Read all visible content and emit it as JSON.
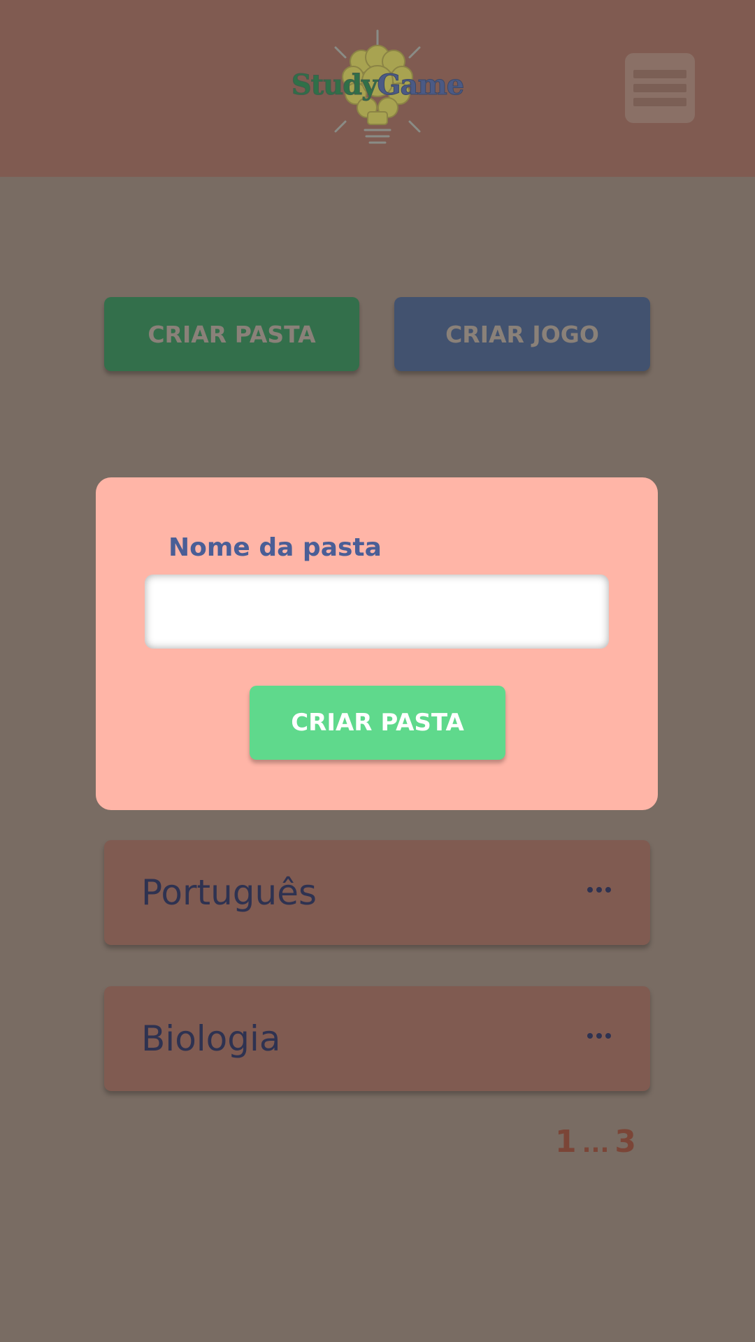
{
  "header": {
    "logo_part1": "Study",
    "logo_part2": "Game",
    "menu_icon": "hamburger-menu-icon"
  },
  "actions": {
    "create_folder_label": "CRIAR PASTA",
    "create_game_label": "CRIAR JOGO"
  },
  "form": {
    "field_label": "Nome da pasta",
    "field_value": "",
    "field_placeholder": "",
    "submit_label": "CRIAR PASTA"
  },
  "folders": [
    {
      "name": "Português",
      "menu_icon": "more-dots-icon"
    },
    {
      "name": "Biologia",
      "menu_icon": "more-dots-icon"
    }
  ],
  "pagination": {
    "current": "1",
    "separator": "...",
    "last": "3"
  },
  "colors": {
    "overlay_background": "#796c63",
    "header": "#805b51",
    "card": "#ffb5a7",
    "primary_green": "#5fd98c",
    "dim_green": "#336f4b",
    "dim_blue": "#42526f",
    "folder_row": "#805b51",
    "folder_text": "#2e3251",
    "label_blue": "#4a5e96",
    "pagination_text": "#7b4537"
  }
}
